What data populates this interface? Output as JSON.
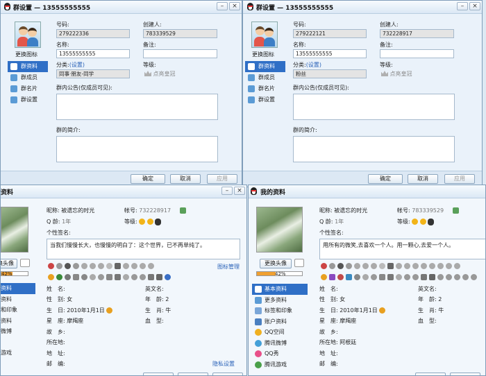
{
  "colors": {
    "accent": "#2f6fc6",
    "link": "#2a62b8",
    "window_bg": "#eaf2fa",
    "title_grad": "#dbe8f5"
  },
  "group1": {
    "title": "群设置 — 13555555555",
    "change_icon": "更换图标",
    "nav": [
      "群资料",
      "群成员",
      "群名片",
      "群设置"
    ],
    "number_label": "号码:",
    "number": "279222336",
    "creator_label": "创建人:",
    "creator": "783339529",
    "name_label": "名称:",
    "name": "13555555555",
    "note_label": "备注:",
    "note": "",
    "category_label": "分类:",
    "category_link": "(设置)",
    "category_value": "同事·朋友-同学",
    "level_label": "等级:",
    "level_text": "点亮皇冠",
    "announce_label": "群内公告(仅成员可见):",
    "intro_label": "群的简介:",
    "ok": "确定",
    "cancel": "取消",
    "apply": "应用"
  },
  "group2": {
    "title": "群设置 — 13555555555",
    "change_icon": "更换图标",
    "nav": [
      "群资料",
      "群成员",
      "群名片",
      "群设置"
    ],
    "number_label": "号码:",
    "number": "279222121",
    "creator_label": "创建人:",
    "creator": "732228917",
    "name_label": "名称:",
    "name": "13555555555",
    "note_label": "备注:",
    "note": "",
    "category_label": "分类:",
    "category_link": "(设置)",
    "category_value": "粉丝",
    "level_label": "等级:",
    "level_text": "点亮皇冠",
    "announce_label": "群内公告(仅成员可见):",
    "intro_label": "群的简介:",
    "ok": "确定",
    "cancel": "取消",
    "apply": "应用"
  },
  "profile1": {
    "title": "资料",
    "nick_label": "昵称:",
    "nick": "被遗忘的时光",
    "account_label": "帐号:",
    "account": "732228917",
    "qage_label": "Q 龄:",
    "qage": "1年",
    "level_label": "等级:",
    "sig_label": "个性签名:",
    "signature": "当我们慢慢长大，也慢慢的明白了：这个世界，已不再单纯了。",
    "change_avatar": "换头像",
    "progress": "42%",
    "icon_manage": "图标管理",
    "nav": [
      "资料",
      "资料",
      "和印象",
      "资料",
      "微博",
      "",
      "游戏"
    ],
    "rows": [
      {
        "l": "姓　名:",
        "v": ""
      },
      {
        "l": "性　别:",
        "v": "女"
      },
      {
        "l": "生　日:",
        "v": "2010年1月1日"
      },
      {
        "l": "星　座:",
        "v": "摩羯座"
      },
      {
        "l": "故　乡:",
        "v": ""
      },
      {
        "l": "所在地:",
        "v": ""
      },
      {
        "l": "地　址:",
        "v": ""
      },
      {
        "l": "邮　编:",
        "v": ""
      }
    ],
    "rrows": [
      {
        "l": "英文名:",
        "v": ""
      },
      {
        "l": "年　龄:",
        "v": "2"
      },
      {
        "l": "生　肖:",
        "v": "牛"
      },
      {
        "l": "血　型:",
        "v": ""
      }
    ],
    "privacy": "隐私设置"
  },
  "profile2": {
    "title": "我的资料",
    "nick_label": "昵称:",
    "nick": "被遗忘的时光",
    "account_label": "帐号:",
    "account": "783339529",
    "qage_label": "Q 龄:",
    "qage": "1年",
    "level_label": "等级:",
    "sig_label": "个性签名:",
    "signature": "用所有的微笑,去喜欢一个人。用一颗心,去爱一个人。",
    "change_avatar": "更换头像",
    "progress": "42%",
    "nav": [
      "基本资料",
      "更多资料",
      "标签和印象",
      "账户资料",
      "QQ空间",
      "腾讯微博",
      "QQ秀",
      "腾讯游戏"
    ],
    "rows": [
      {
        "l": "姓　名:",
        "v": ""
      },
      {
        "l": "性　别:",
        "v": "女"
      },
      {
        "l": "生　日:",
        "v": "2010年1月1日"
      },
      {
        "l": "星　座:",
        "v": "摩羯座"
      },
      {
        "l": "故　乡:",
        "v": ""
      },
      {
        "l": "所在地:",
        "v": "阿根廷"
      },
      {
        "l": "地　址:",
        "v": ""
      },
      {
        "l": "邮　编:",
        "v": ""
      }
    ],
    "rrows": [
      {
        "l": "英文名:",
        "v": ""
      },
      {
        "l": "年　龄:",
        "v": "2"
      },
      {
        "l": "生　肖:",
        "v": "牛"
      },
      {
        "l": "血　型:",
        "v": ""
      }
    ]
  }
}
